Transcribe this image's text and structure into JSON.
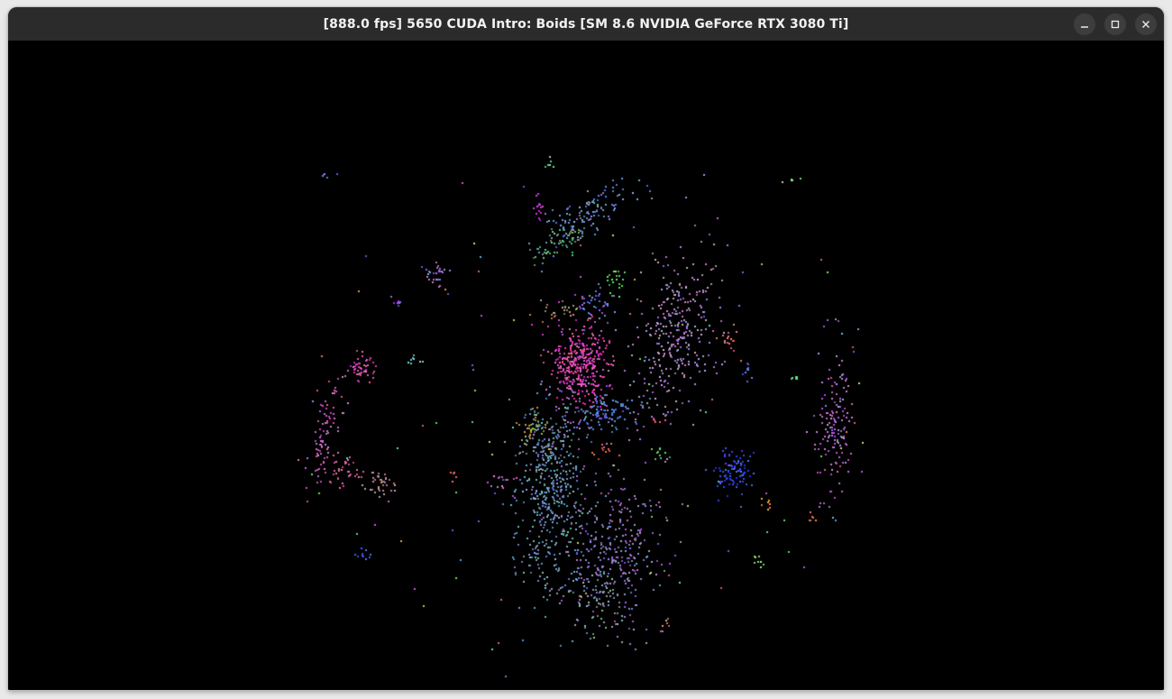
{
  "window": {
    "title": "[888.0 fps] 5650 CUDA Intro: Boids [SM 8.6 NVIDIA GeForce RTX 3080 Ti]",
    "controls": [
      {
        "name": "minimize",
        "icon": "minimize-icon"
      },
      {
        "name": "maximize",
        "icon": "maximize-icon"
      },
      {
        "name": "close",
        "icon": "close-icon"
      }
    ]
  },
  "colors": {
    "titlebar": "#2b2b2b",
    "title_text": "#f2f2f2",
    "viewport_background": "#000000"
  },
  "simulation": {
    "fps": 888.0,
    "course": "5650",
    "project": "CUDA Intro: Boids",
    "gpu": "NVIDIA GeForce RTX 3080 Ti",
    "sm": "8.6"
  }
}
